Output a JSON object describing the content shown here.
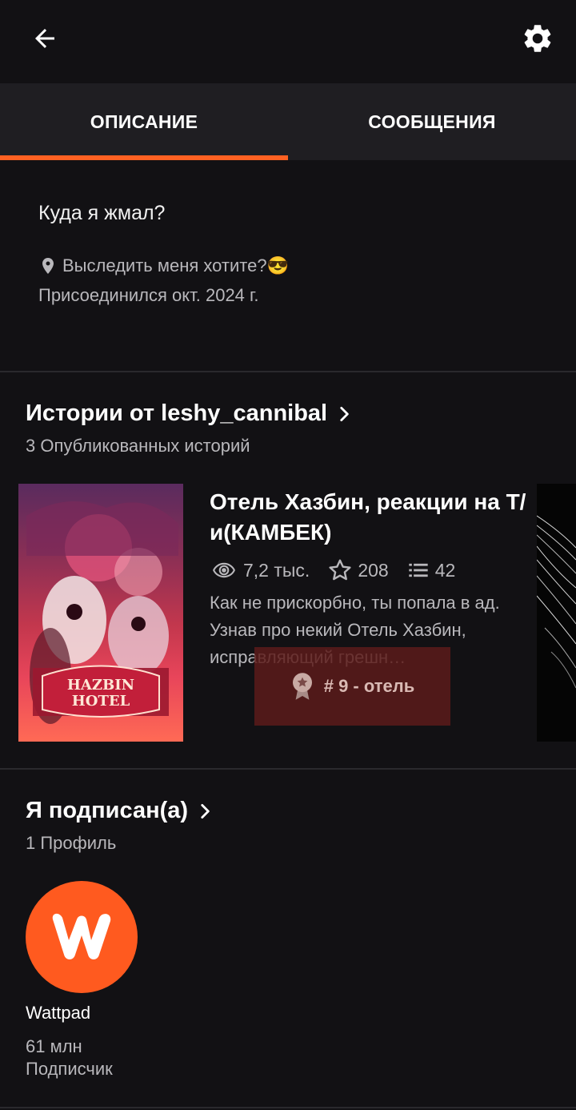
{
  "header": {
    "back_icon": "arrow-left-icon",
    "settings_icon": "gear-icon"
  },
  "tabs": [
    {
      "label": "ОПИСАНИЕ",
      "active": true
    },
    {
      "label": "СООБЩЕНИЯ",
      "active": false
    }
  ],
  "accent_color": "#ff6122",
  "about": {
    "description": "Куда я жмал?",
    "location": "Выследить меня хотите?😎",
    "joined": "Присоединился окт. 2024 г."
  },
  "stories": {
    "title": "Истории от leshy_cannibal",
    "count_text": "3 Опубликованных историй",
    "items": [
      {
        "title": "Отель Хазбин, реакции на Т/и(КАМБЕК)",
        "reads": "7,2 тыс.",
        "votes": "208",
        "parts": "42",
        "description": "Как не прискорбно, ты попала в ад. Узнав про некий Отель Хазбин, исправляющий грешн…",
        "rank": "# 9 - отель",
        "cover_text": "HAZBIN HOTEL"
      }
    ]
  },
  "following": {
    "title": "Я подписан(а)",
    "count_text": "1 Профиль",
    "profiles": [
      {
        "name": "Wattpad",
        "followers": "61 млн",
        "followers_label": "Подписчик"
      }
    ]
  }
}
